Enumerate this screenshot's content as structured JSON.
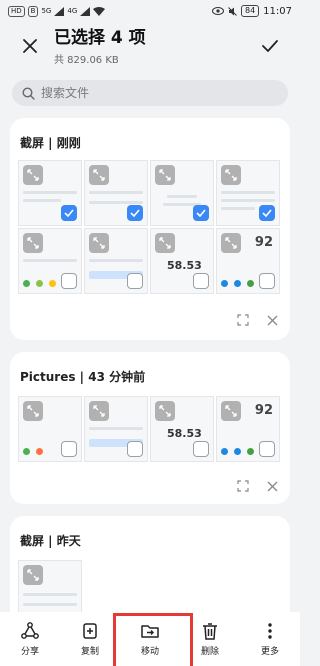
{
  "status_bar": {
    "left_badges": [
      "HD",
      "B"
    ],
    "signal_labels": [
      "5G",
      "4G"
    ],
    "battery": "84",
    "time": "11:07"
  },
  "header": {
    "title": "已选择 4 项",
    "subtitle": "共 829.06 KB"
  },
  "search": {
    "placeholder": "搜索文件"
  },
  "sections": [
    {
      "title": "截屏 | 刚刚"
    },
    {
      "title": "Pictures | 43 分钟前"
    },
    {
      "title": "截屏 | 昨天"
    }
  ],
  "thumb_texts": {
    "gauge": "92",
    "amount": "58.53"
  },
  "toolbar": {
    "share": "分享",
    "copy": "复制",
    "move": "移动",
    "delete": "删除",
    "more": "更多"
  },
  "colors": {
    "accent": "#3a88f5",
    "highlight": "#e53935"
  },
  "icons": {
    "close": "close-icon",
    "confirm": "check-icon",
    "search": "search-icon",
    "share": "share-icon",
    "copy": "copy-icon",
    "move": "move-icon",
    "delete": "trash-icon",
    "more": "more-vertical-icon"
  }
}
